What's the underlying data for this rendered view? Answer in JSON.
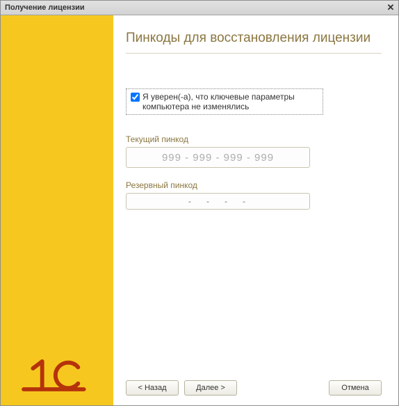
{
  "titlebar": {
    "title": "Получение лицензии"
  },
  "heading": "Пинкоды для восстановления лицензии",
  "confirm": {
    "checked": true,
    "label": "Я уверен(-а), что ключевые параметры компьютера не изменялись"
  },
  "current_pin": {
    "label": "Текущий пинкод",
    "value": "999 - 999 - 999 - 999"
  },
  "backup_pin": {
    "label": "Резервный пинкод",
    "placeholder": "-   -   -   -"
  },
  "buttons": {
    "back": "< Назад",
    "next": "Далее >",
    "cancel": "Отмена"
  }
}
